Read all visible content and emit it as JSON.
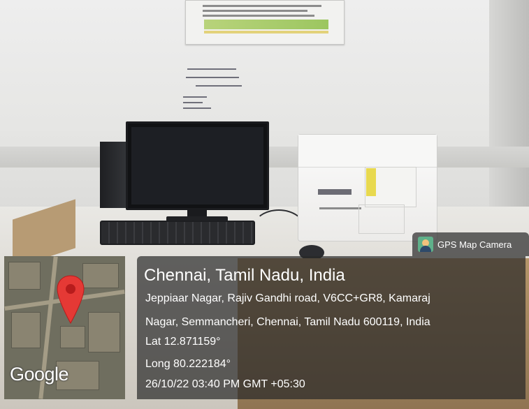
{
  "location": {
    "title": "Chennai, Tamil Nadu, India",
    "address_line1": "Jeppiaar Nagar, Rajiv Gandhi road, V6CC+GR8, Kamaraj",
    "address_line2": "Nagar, Semmancheri, Chennai, Tamil Nadu 600119, India",
    "lat": "Lat 12.871159°",
    "long": "Long 80.222184°",
    "timestamp": "26/10/22 03:40 PM GMT +05:30"
  },
  "badge": {
    "label": "GPS Map Camera",
    "icon": "gps-map-camera-app-icon"
  },
  "map": {
    "watermark": "Google",
    "pin_color": "#e53935",
    "icon": "map-pin-icon"
  },
  "colors": {
    "overlay_bg": "#282828",
    "text": "#ffffff"
  }
}
